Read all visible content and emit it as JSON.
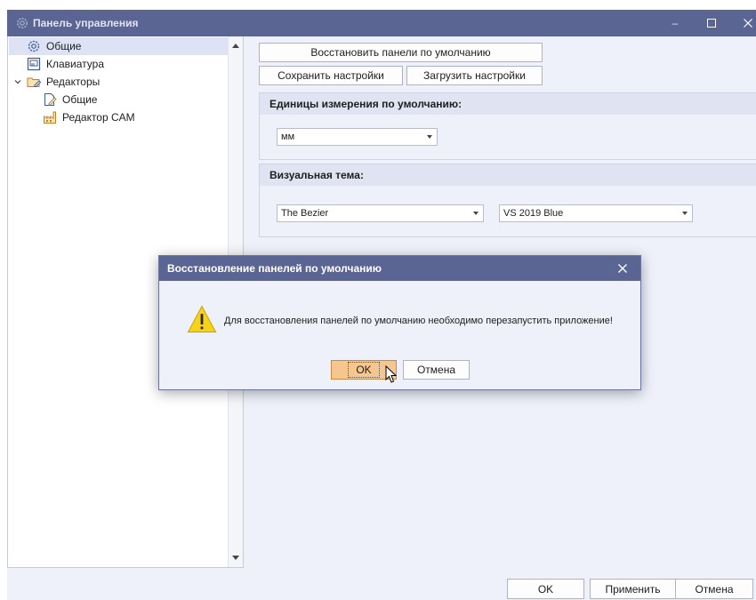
{
  "window": {
    "title": "Панель управления",
    "controls": {
      "minimize": "–",
      "maximize": "☐",
      "close": "✕"
    }
  },
  "tree": {
    "items": [
      {
        "label": "Общие",
        "icon": "gear-icon",
        "selected": true
      },
      {
        "label": "Клавиатура",
        "icon": "keyboard-icon"
      },
      {
        "label": "Редакторы",
        "icon": "folder-edit-icon",
        "expanded": true
      },
      {
        "label": "Общие",
        "icon": "document-edit-icon"
      },
      {
        "label": "Редактор CAM",
        "icon": "factory-icon"
      }
    ]
  },
  "toolbar": {
    "restore_label": "Восстановить панели по умолчанию",
    "save_label": "Сохранить настройки",
    "load_label": "Загрузить настройки"
  },
  "units_group": {
    "header": "Единицы измерения по умолчанию:",
    "value": "мм"
  },
  "theme_group": {
    "header": "Визуальная тема:",
    "skin_value": "The Bezier",
    "palette_value": "VS 2019 Blue"
  },
  "dialog": {
    "title": "Восстановление панелей по умолчанию",
    "message": "Для восстановления панелей по умолчанию необходимо перезапустить приложение!",
    "ok_label": "OK",
    "cancel_label": "Отмена"
  },
  "footer": {
    "ok_label": "OK",
    "apply_label": "Применить",
    "cancel_label": "Отмена"
  },
  "colors": {
    "titlebar": "#5b6593",
    "background": "#eef0fa",
    "ok_accent": "#f5c78e",
    "warning": "#f7d21a"
  }
}
